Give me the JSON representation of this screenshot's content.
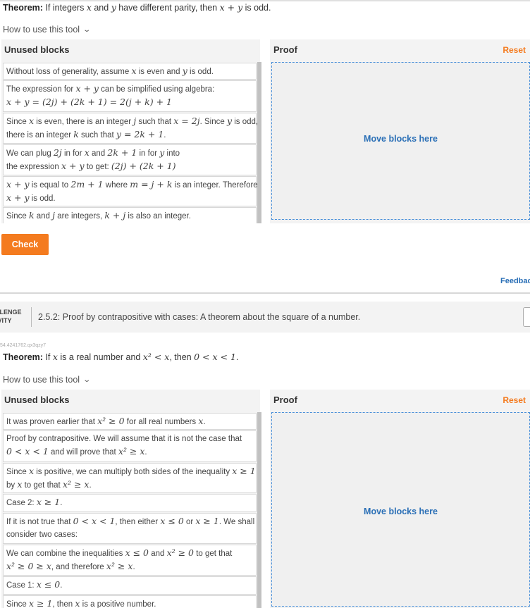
{
  "section1": {
    "theorem_label": "Theorem:",
    "theorem_parts": [
      "If integers ",
      "x",
      " and ",
      "y",
      " have different parity, then ",
      "x + y",
      " is odd."
    ],
    "howto": "How to use this tool",
    "unused_title": "Unused blocks",
    "proof_title": "Proof",
    "reset": "Reset",
    "move_here": "Move blocks here",
    "blocks": [
      {
        "lines": [
          [
            "Without loss of generality, assume ",
            "x",
            " is even and ",
            "y",
            " is odd."
          ]
        ]
      },
      {
        "lines": [
          [
            "The expression for ",
            "x + y",
            " can be simplified using algebra:"
          ],
          [
            "",
            "x + y = (2j) + (2k + 1) = 2(j + k) + 1"
          ]
        ]
      },
      {
        "lines": [
          [
            "Since ",
            "x",
            " is even, there is an integer ",
            "j",
            " such that ",
            "x = 2j",
            ". Since ",
            "y",
            " is odd,"
          ],
          [
            "there is an integer ",
            "k",
            " such that ",
            "y = 2k + 1",
            "."
          ]
        ]
      },
      {
        "lines": [
          [
            "We can plug ",
            "2j",
            " in for ",
            "x",
            " and ",
            "2k + 1",
            " in for ",
            "y",
            " into"
          ],
          [
            " the expression ",
            "x + y",
            " to get: ",
            "(2j) + (2k + 1)"
          ]
        ]
      },
      {
        "lines": [
          [
            "",
            "x + y",
            " is equal to ",
            "2m + 1",
            " where ",
            "m = j + k",
            " is an integer. Therefore"
          ],
          [
            "",
            "x + y",
            " is odd."
          ]
        ]
      },
      {
        "lines": [
          [
            "Since ",
            "k",
            " and ",
            "j",
            " are integers, ",
            "k + j",
            " is also an integer."
          ]
        ]
      }
    ],
    "check": "Check",
    "feedback": "Feedbac"
  },
  "activity": {
    "label_line1": "LLENGE",
    "label_line2": "IVITY",
    "title": "2.5.2: Proof by contrapositive with cases: A theorem about the square of a number.",
    "id": "54.4241762.qx3qzy7"
  },
  "section2": {
    "theorem_label": "Theorem:",
    "theorem_parts": [
      "If ",
      "x",
      " is a real number and ",
      "x² < x",
      ", then ",
      "0 < x < 1",
      "."
    ],
    "howto": "How to use this tool",
    "unused_title": "Unused blocks",
    "proof_title": "Proof",
    "reset": "Reset",
    "move_here": "Move blocks here",
    "blocks": [
      {
        "lines": [
          [
            "It was proven earlier that ",
            "x² ≥ 0",
            " for all real numbers ",
            "x",
            "."
          ]
        ]
      },
      {
        "lines": [
          [
            "Proof by contrapositive. We will assume that it is not the case that"
          ],
          [
            "",
            "0 < x < 1",
            " and will prove that ",
            "x² ≥ x",
            "."
          ]
        ]
      },
      {
        "lines": [
          [
            "Since ",
            "x",
            " is positive, we can multiply both sides of the inequality ",
            "x ≥ 1"
          ],
          [
            "by ",
            "x",
            " to get that ",
            "x² ≥ x",
            "."
          ]
        ]
      },
      {
        "lines": [
          [
            "Case 2: ",
            "x ≥ 1",
            "."
          ]
        ]
      },
      {
        "lines": [
          [
            "If it is not true that ",
            "0 < x < 1",
            ", then either ",
            "x ≤ 0",
            " or ",
            "x ≥ 1",
            ". We shall"
          ],
          [
            "consider two cases:"
          ]
        ]
      },
      {
        "lines": [
          [
            "We can combine the inequalities ",
            "x ≤ 0",
            " and ",
            "x² ≥ 0",
            " to get that"
          ],
          [
            "",
            "x² ≥ 0 ≥ x",
            ", and therefore ",
            "x² ≥ x",
            "."
          ]
        ]
      },
      {
        "lines": [
          [
            "Case 1: ",
            "x ≤ 0",
            "."
          ]
        ]
      },
      {
        "lines": [
          [
            "Since ",
            "x ≥ 1",
            ", then ",
            "x",
            " is a positive number."
          ]
        ]
      }
    ]
  }
}
